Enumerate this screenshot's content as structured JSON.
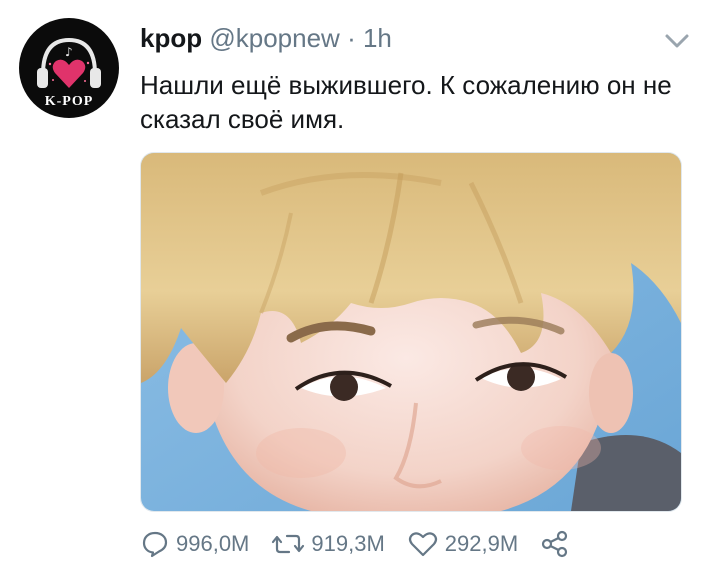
{
  "tweet": {
    "display_name": "kpop",
    "handle": "@kpopnew",
    "separator": "·",
    "time": "1h",
    "text": "Нашли ещё выжившего. К сожалению он не сказал своё имя.",
    "avatar": {
      "label": "K-POP",
      "icon": "headphones-heart-logo"
    },
    "media": {
      "type": "photo"
    },
    "menu_icon": "chevron-down-icon"
  },
  "actions": {
    "reply": {
      "icon": "reply-icon",
      "count": "996,0M"
    },
    "retweet": {
      "icon": "retweet-icon",
      "count": "919,3M"
    },
    "like": {
      "icon": "heart-icon",
      "count": "292,9M"
    },
    "share": {
      "icon": "share-icon"
    }
  },
  "colors": {
    "text": "#14171a",
    "secondary": "#657786",
    "background": "#ffffff",
    "avatar_bg": "#0b0b0b",
    "logo_heart": "#e0336b"
  }
}
